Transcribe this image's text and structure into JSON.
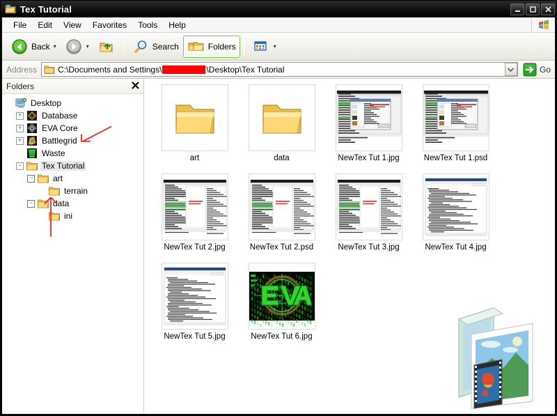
{
  "window": {
    "title": "Tex Tutorial",
    "title_icon": "folder-window-icon",
    "controls": {
      "minimize": "minimize-button",
      "maximize": "maximize-button",
      "close": "close-button"
    }
  },
  "menubar": {
    "items": [
      {
        "label": "File"
      },
      {
        "label": "Edit"
      },
      {
        "label": "View"
      },
      {
        "label": "Favorites"
      },
      {
        "label": "Tools"
      },
      {
        "label": "Help"
      }
    ],
    "brand_icon": "windows-flag-icon"
  },
  "toolbar": {
    "back_label": "Back",
    "back_icon": "back-arrow-icon",
    "forward_icon": "forward-arrow-icon",
    "up_icon": "up-folder-icon",
    "search_label": "Search",
    "search_icon": "magnifier-icon",
    "folders_label": "Folders",
    "folders_icon": "folders-icon",
    "folders_pressed": true,
    "views_icon": "views-icon",
    "dropdown_caret": "▾"
  },
  "address": {
    "label": "Address",
    "folder_icon": "folder-icon",
    "path_prefix": "C:\\Documents and Settings\\",
    "path_redacted": true,
    "path_suffix": "\\Desktop\\Tex Tutorial",
    "dropdown_icon": "chevron-down-icon",
    "go_label": "Go",
    "go_icon": "go-arrow-icon"
  },
  "sidebar": {
    "header_title": "Folders",
    "close_icon": "close-icon",
    "tree": [
      {
        "label": "Desktop",
        "indent": 0,
        "expander": "none",
        "icon": "desktop-icon",
        "selected": false
      },
      {
        "label": "Database",
        "indent": 1,
        "expander": "plus",
        "icon": "database-icon",
        "selected": false
      },
      {
        "label": "EVA Core",
        "indent": 1,
        "expander": "plus",
        "icon": "eva-core-icon",
        "selected": false
      },
      {
        "label": "Battlegrid",
        "indent": 1,
        "expander": "plus",
        "icon": "battlegrid-icon",
        "selected": false
      },
      {
        "label": "Waste",
        "indent": 1,
        "expander": "none",
        "icon": "waste-icon",
        "selected": false
      },
      {
        "label": "Tex Tutorial",
        "indent": 1,
        "expander": "minus",
        "icon": "folder-icon",
        "selected": true
      },
      {
        "label": "art",
        "indent": 2,
        "expander": "minus-green",
        "icon": "folder-icon",
        "selected": false
      },
      {
        "label": "terrain",
        "indent": 3,
        "expander": "none",
        "icon": "folder-icon",
        "selected": false
      },
      {
        "label": "data",
        "indent": 2,
        "expander": "minus-green",
        "icon": "folder-icon",
        "selected": false
      },
      {
        "label": "ini",
        "indent": 3,
        "expander": "none",
        "icon": "folder-icon",
        "selected": false
      }
    ],
    "annotations": [
      {
        "name": "arrow-to-tex-tutorial",
        "color": "#ff1010",
        "type": "diagonal"
      },
      {
        "name": "arrow-to-ini",
        "color": "#ff1010",
        "type": "vertical"
      }
    ]
  },
  "files": [
    {
      "label": "art",
      "thumb": "folder",
      "type": "folder"
    },
    {
      "label": "data",
      "thumb": "folder",
      "type": "folder"
    },
    {
      "label": "NewTex Tut 1.jpg",
      "thumb": "dialog",
      "type": "image"
    },
    {
      "label": "NewTex Tut 1.psd",
      "thumb": "dialog",
      "type": "image"
    },
    {
      "label": "NewTex Tut 2.jpg",
      "thumb": "editor",
      "type": "image"
    },
    {
      "label": "NewTex Tut 2.psd",
      "thumb": "editor",
      "type": "image"
    },
    {
      "label": "NewTex Tut 3.jpg",
      "thumb": "editor",
      "type": "image"
    },
    {
      "label": "NewTex Tut 4.jpg",
      "thumb": "code",
      "type": "image"
    },
    {
      "label": "NewTex Tut 5.jpg",
      "thumb": "code",
      "type": "image"
    },
    {
      "label": "NewTex Tut 6.jpg",
      "thumb": "eva-logo",
      "type": "image"
    }
  ],
  "watermark": {
    "icon": "my-pictures-folder-watermark"
  },
  "colors": {
    "titlebar": "#0a0a0a",
    "title_text": "#ffffff",
    "toolbar_bg": "#f1f1ec",
    "pressed_border": "#7ac943",
    "accent_green": "#2e9e2e",
    "annotation_red": "#ff1010",
    "selection": "#e8e8e8",
    "redaction": "#ff0000"
  }
}
